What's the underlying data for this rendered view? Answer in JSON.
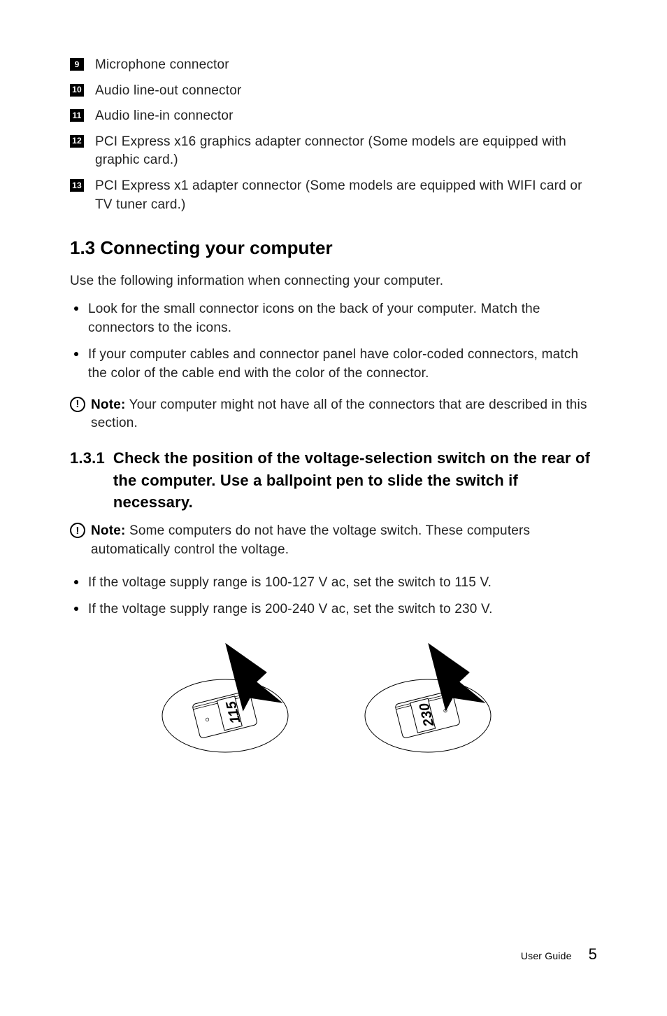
{
  "numbered_items": [
    {
      "num": "9",
      "text": "Microphone connector"
    },
    {
      "num": "10",
      "text": "Audio line-out connector"
    },
    {
      "num": "11",
      "text": "Audio line-in connector"
    },
    {
      "num": "12",
      "text": "PCI Express x16 graphics adapter connector (Some models are equipped with graphic card.)"
    },
    {
      "num": "13",
      "text": "PCI Express x1 adapter connector (Some models are equipped with WIFI card or TV tuner card.)"
    }
  ],
  "heading1": "1.3 Connecting your computer",
  "intro": "Use the following information when connecting your computer.",
  "bullets1": [
    "Look for the small connector icons on the back of your computer. Match the connectors to the icons.",
    "If your computer cables and connector panel have color-coded connectors, match the color of the cable end with the color of the connector."
  ],
  "note1_label": "Note:",
  "note1_text": " Your computer might not have all of the connectors that are described in this section.",
  "heading2_num": "1.3.1",
  "heading2_text": "Check the position of the voltage-selection switch on the rear of the computer. Use a ballpoint pen to slide the switch if necessary.",
  "note2_label": "Note:",
  "note2_text": " Some computers do not have the voltage switch. These computers automatically control the voltage.",
  "bullets2": [
    "If the voltage supply range is 100-127 V ac, set the switch to 115 V.",
    "If the voltage supply range is 200-240 V ac, set the switch to 230 V."
  ],
  "switch_labels": {
    "left": "115",
    "right": "230"
  },
  "footer": {
    "label": "User Guide",
    "page": "5"
  }
}
